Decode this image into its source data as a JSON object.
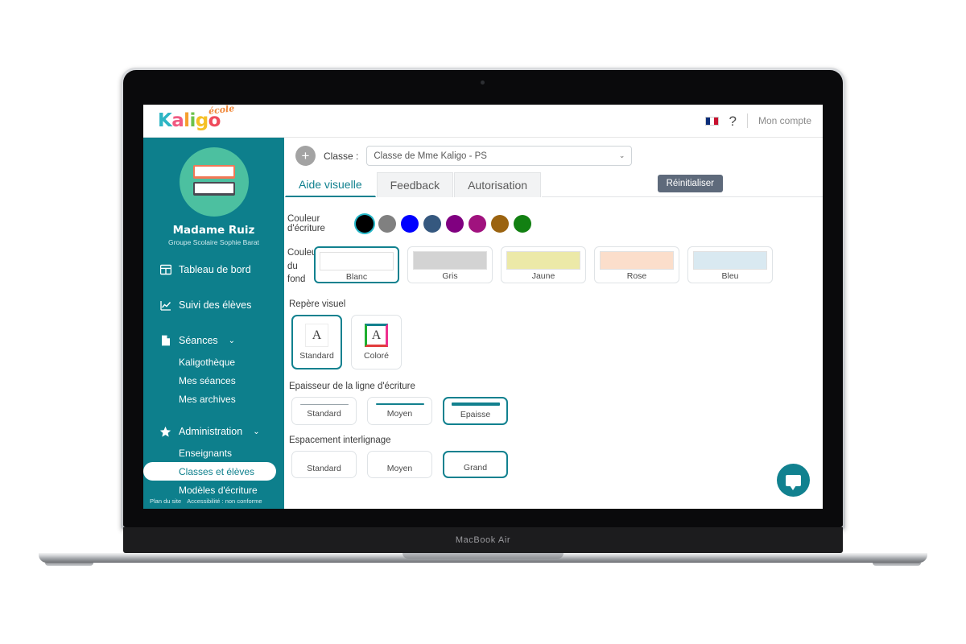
{
  "device": {
    "model_label": "MacBook Air"
  },
  "topbar": {
    "logo": {
      "letters": [
        {
          "char": "K",
          "color": "#2db5c4"
        },
        {
          "char": "a",
          "color": "#f05a82"
        },
        {
          "char": "l",
          "color": "#f59f2e"
        },
        {
          "char": "i",
          "color": "#6cc24a"
        },
        {
          "char": "g",
          "color": "#f5c026"
        },
        {
          "char": "o",
          "color": "#ef4b5c"
        }
      ],
      "superscript": "école"
    },
    "language_flag": "fr-flag-icon",
    "help_label": "?",
    "account_label": "Mon compte"
  },
  "sidebar": {
    "avatar_icon": "books-avatar-icon",
    "user_name": "Madame Ruiz",
    "user_school": "Groupe Scolaire Sophie Barat",
    "nav": [
      {
        "label": "Tableau de bord",
        "icon": "dashboard-grid-icon",
        "expandable": false
      },
      {
        "label": "Suivi des élèves",
        "icon": "chart-line-icon",
        "expandable": false
      },
      {
        "label": "Séances",
        "icon": "document-icon",
        "expandable": true,
        "caret": "⌄"
      },
      {
        "label": "Administration",
        "icon": "star-icon",
        "expandable": true,
        "caret": "⌄"
      }
    ],
    "seances_sub": [
      "Kaligothèque",
      "Mes séances",
      "Mes archives"
    ],
    "administration_sub": [
      "Enseignants",
      "Classes et élèves",
      "Modèles d'écriture"
    ],
    "active_sub_item": "Classes et élèves",
    "footer": {
      "sitemap": "Plan du site",
      "accessibility": "Accessibilité : non conforme"
    }
  },
  "main": {
    "class_bar": {
      "add_button": "+",
      "label": "Classe :",
      "selected_class": "Classe de Mme Kaligo - PS",
      "caret": "⌄"
    },
    "tabs": [
      {
        "label": "Aide visuelle",
        "active": true
      },
      {
        "label": "Feedback",
        "active": false
      },
      {
        "label": "Autorisation",
        "active": false
      }
    ],
    "reset_button": "Réinitialiser",
    "writing_color": {
      "label": "Couleur d'écriture",
      "options": [
        {
          "name": "Noir",
          "hex": "#000000",
          "selected": true
        },
        {
          "name": "Gris",
          "hex": "#808080",
          "selected": false
        },
        {
          "name": "Bleu",
          "hex": "#0000ff",
          "selected": false
        },
        {
          "name": "Bleu acier",
          "hex": "#35587f",
          "selected": false
        },
        {
          "name": "Violet",
          "hex": "#800080",
          "selected": false
        },
        {
          "name": "Magenta",
          "hex": "#a0127e",
          "selected": false
        },
        {
          "name": "Ocre",
          "hex": "#9b6310",
          "selected": false
        },
        {
          "name": "Vert",
          "hex": "#128012",
          "selected": false
        }
      ],
      "selection_ring": "#25b7c8"
    },
    "background_color": {
      "label_lines": [
        "Couleur",
        "du",
        "fond"
      ],
      "options": [
        {
          "label": "Blanc",
          "hex": "#ffffff",
          "selected": true
        },
        {
          "label": "Gris",
          "hex": "#d3d3d3",
          "selected": false
        },
        {
          "label": "Jaune",
          "hex": "#ece9a8",
          "selected": false
        },
        {
          "label": "Rose",
          "hex": "#fbdecb",
          "selected": false
        },
        {
          "label": "Bleu",
          "hex": "#d9e9f1",
          "selected": false
        }
      ]
    },
    "visual_marker": {
      "label": "Repère visuel",
      "options": [
        {
          "label": "Standard",
          "glyph": "A",
          "style": "plain",
          "selected": true
        },
        {
          "label": "Coloré",
          "glyph": "A",
          "style": "colored",
          "selected": false
        }
      ],
      "colored_borders": {
        "top": "#12808e",
        "right": "#ee2f8e",
        "bottom": "#e23b3b",
        "left": "#1eae2e"
      }
    },
    "line_thickness": {
      "label": "Epaisseur de la ligne d'écriture",
      "options": [
        {
          "label": "Standard",
          "weight": "thin",
          "selected": false
        },
        {
          "label": "Moyen",
          "weight": "medium",
          "selected": false
        },
        {
          "label": "Epaisse",
          "weight": "thick",
          "selected": true
        }
      ]
    },
    "line_spacing": {
      "label": "Espacement interlignage",
      "options": [
        {
          "label": "Standard",
          "selected": false
        },
        {
          "label": "Moyen",
          "selected": false
        },
        {
          "label": "Grand",
          "selected": true
        }
      ]
    },
    "chat_button_icon": "chat-bubble-icon",
    "accent_color": "#11818f",
    "sidebar_color": "#0d7f8c"
  }
}
